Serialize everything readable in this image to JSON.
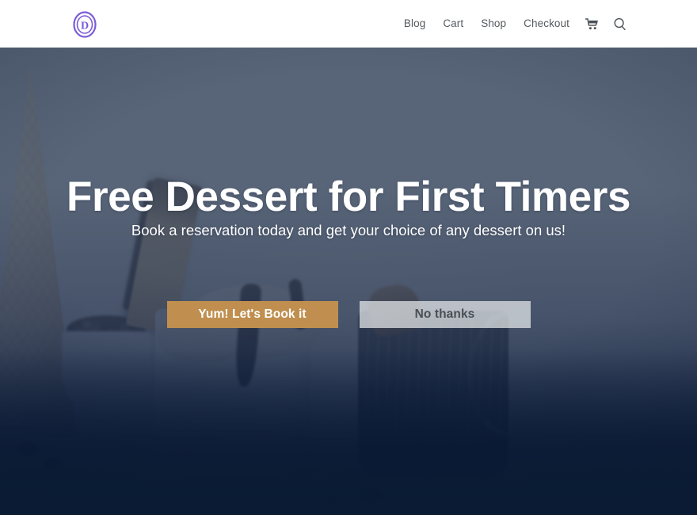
{
  "header": {
    "logo": {
      "name": "divi-logo",
      "letter": "D",
      "color": "#7b5cd6"
    },
    "nav_items": [
      {
        "label": "Blog"
      },
      {
        "label": "Cart"
      },
      {
        "label": "Shop"
      },
      {
        "label": "Checkout"
      }
    ],
    "icons": [
      {
        "name": "shopping-cart-icon"
      },
      {
        "name": "search-icon"
      }
    ],
    "background": "#ffffff",
    "link_color": "#555a5e"
  },
  "hero": {
    "title": "Free Dessert for First Timers",
    "subtitle": "Book a reservation today and get your choice of any dessert on us!",
    "title_color": "#ffffff",
    "overlay_top_color": "#46546a",
    "overlay_bottom_color": "#0a1b33",
    "background_photo": "ice-cream-dessert-photo",
    "buttons": {
      "primary": {
        "label": "Yum! Let's Book it",
        "background": "#c08f4f",
        "text_color": "#ffffff"
      },
      "secondary": {
        "label": "No thanks",
        "background": "rgba(232,234,236,0.72)",
        "text_color": "#4a4f55"
      }
    }
  }
}
